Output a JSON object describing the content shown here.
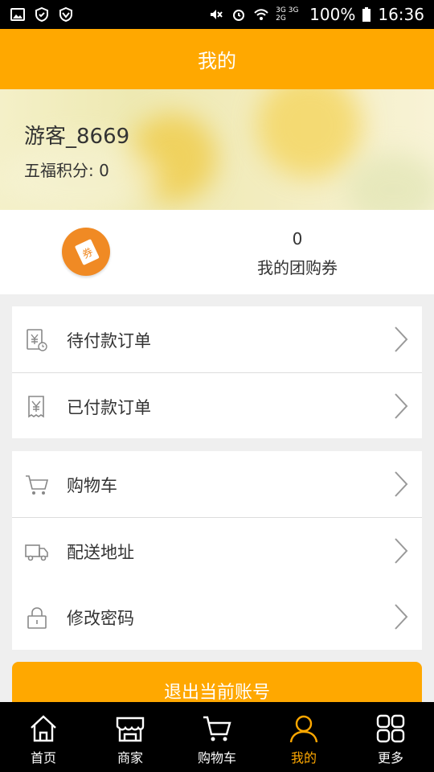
{
  "status_bar": {
    "battery": "100%",
    "time": "16:36",
    "network": "3G 3G 2G"
  },
  "header": {
    "title": "我的"
  },
  "profile": {
    "username": "游客_8669",
    "points": "五福积分: 0"
  },
  "voucher": {
    "count": "0",
    "label": "我的团购券",
    "icon_text": "券"
  },
  "menu": {
    "group1": [
      {
        "label": "待付款订单",
        "icon": "unpaid-order-icon"
      },
      {
        "label": "已付款订单",
        "icon": "paid-order-icon"
      }
    ],
    "group2": [
      {
        "label": "购物车",
        "icon": "cart-icon"
      },
      {
        "label": "配送地址",
        "icon": "truck-icon"
      },
      {
        "label": "修改密码",
        "icon": "lock-icon"
      }
    ]
  },
  "logout": {
    "label": "退出当前账号"
  },
  "bottom_nav": [
    {
      "label": "首页",
      "icon": "home-icon"
    },
    {
      "label": "商家",
      "icon": "store-icon"
    },
    {
      "label": "购物车",
      "icon": "cart-icon"
    },
    {
      "label": "我的",
      "icon": "user-icon",
      "active": true
    },
    {
      "label": "更多",
      "icon": "grid-icon"
    }
  ],
  "colors": {
    "accent": "#ffa800",
    "voucher": "#f08a24"
  }
}
